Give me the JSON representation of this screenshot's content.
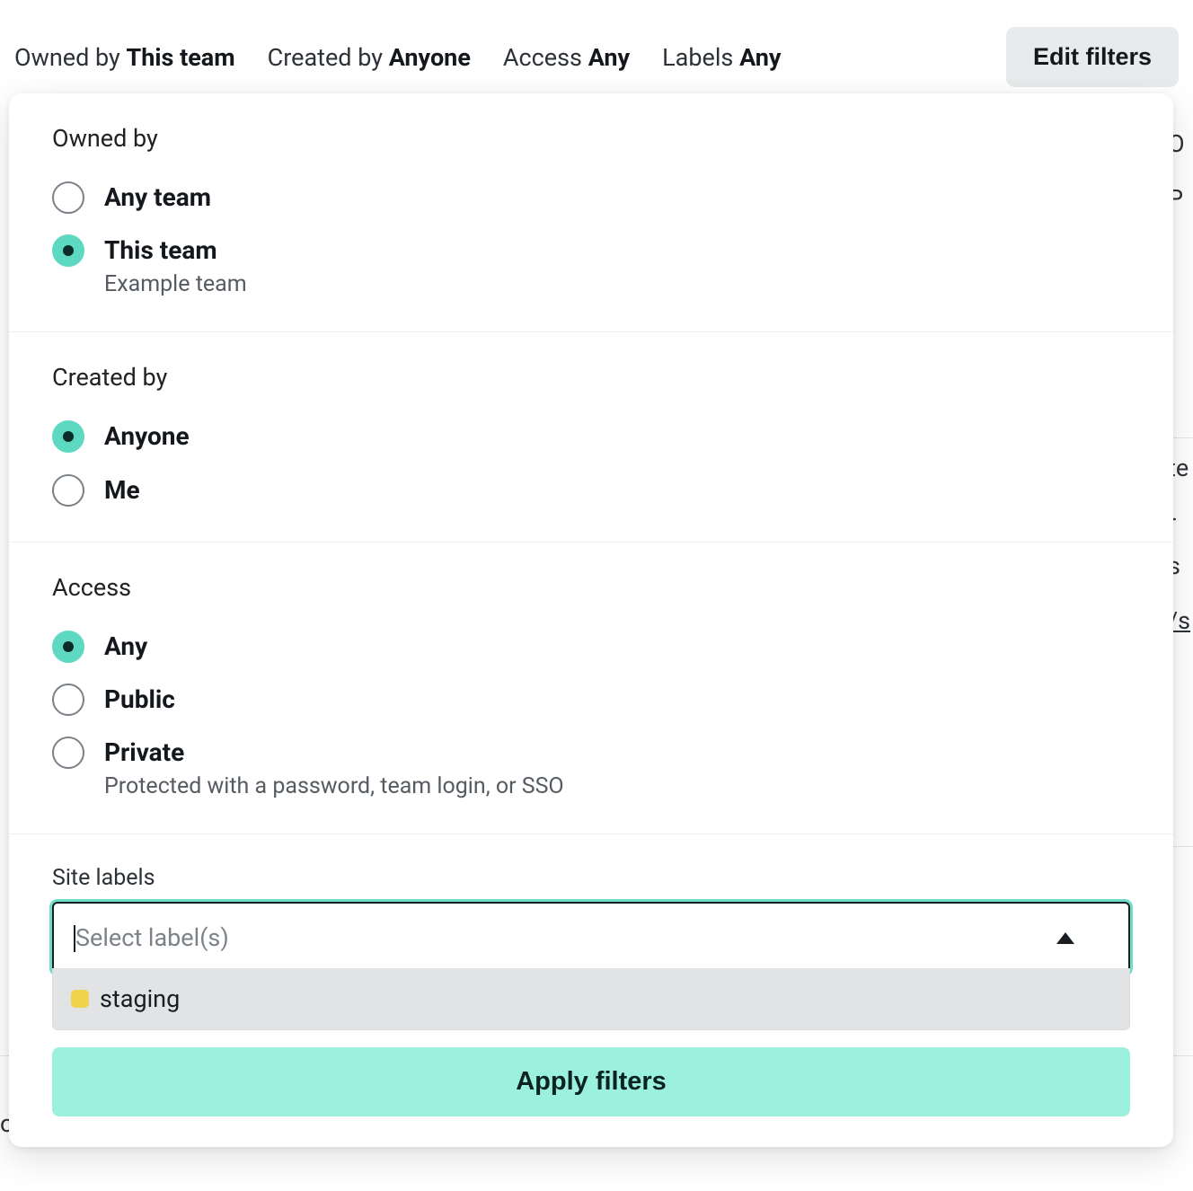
{
  "filterBar": {
    "ownedBy": {
      "label": "Owned by",
      "value": "This team"
    },
    "createdBy": {
      "label": "Created by",
      "value": "Anyone"
    },
    "access": {
      "label": "Access",
      "value": "Any"
    },
    "labels": {
      "label": "Labels",
      "value": "Any"
    },
    "editButton": "Edit filters"
  },
  "panel": {
    "ownedBy": {
      "title": "Owned by",
      "options": [
        {
          "label": "Any team",
          "selected": false
        },
        {
          "label": "This team",
          "sublabel": "Example team",
          "selected": true
        }
      ]
    },
    "createdBy": {
      "title": "Created by",
      "options": [
        {
          "label": "Anyone",
          "selected": true
        },
        {
          "label": "Me",
          "selected": false
        }
      ]
    },
    "access": {
      "title": "Access",
      "options": [
        {
          "label": "Any",
          "selected": true
        },
        {
          "label": "Public",
          "selected": false
        },
        {
          "label": "Private",
          "sublabel": "Protected with a password, team login, or SSO",
          "selected": false
        }
      ]
    },
    "siteLabels": {
      "title": "Site labels",
      "placeholder": "Select label(s)",
      "dropdownItems": [
        {
          "color": "#f3d24b",
          "name": "staging"
        }
      ]
    },
    "applyButton": "Apply filters"
  },
  "bgPeek": {
    "r1": "O",
    "r2": "P",
    "r3": "te",
    "r4": "r s",
    "r5": "/s",
    "bl": "oo"
  }
}
